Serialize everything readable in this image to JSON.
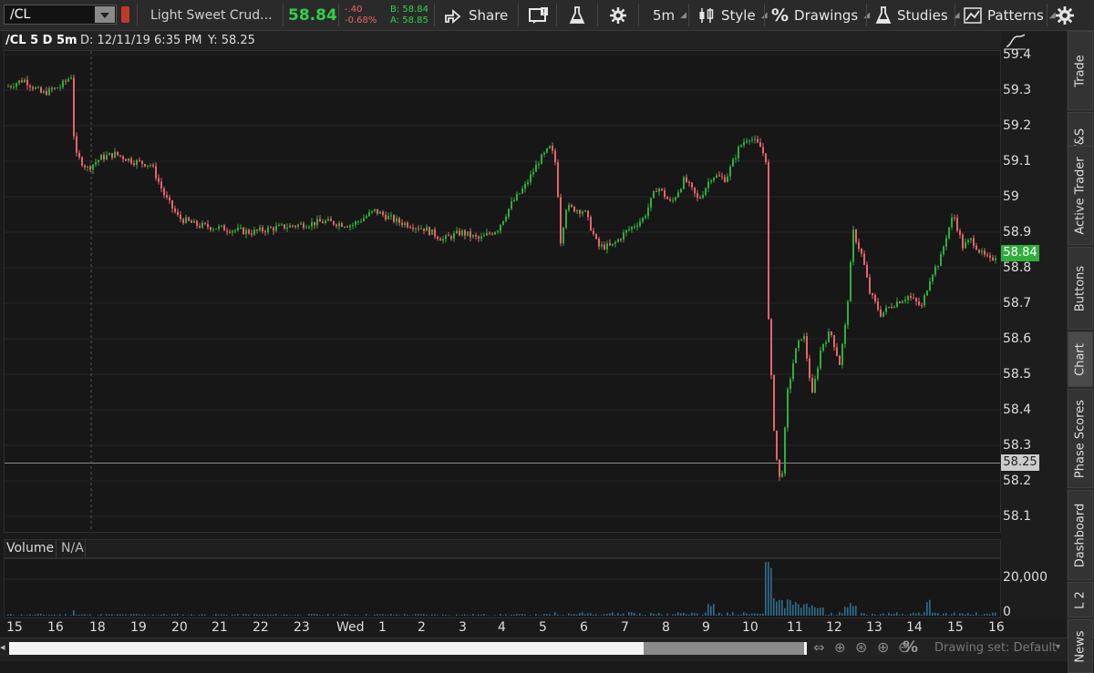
{
  "toolbar": {
    "symbol": "/CL",
    "description": "Light Sweet Crud...",
    "last": "58.84",
    "net_change": "-.40",
    "pct_change": "-0.68%",
    "bid": "B: 58.84",
    "ask": "A: 58.85",
    "share_label": "Share",
    "timeframe": "5m",
    "style_label": "Style",
    "drawings_label": "Drawings",
    "studies_label": "Studies",
    "patterns_label": "Patterns"
  },
  "chart_header": {
    "title": "/CL 5 D 5m",
    "date_readout": "D: 12/11/19 6:35 PM",
    "y_readout": "Y: 58.25"
  },
  "volume_header": {
    "label": "Volume",
    "value": "N/A"
  },
  "price_axis": {
    "ticks": [
      "59.4",
      "59.3",
      "59.2",
      "59.1",
      "59",
      "58.9",
      "58.8",
      "58.7",
      "58.6",
      "58.5",
      "58.4",
      "58.3",
      "58.2",
      "58.1"
    ],
    "last_marker": "58.84",
    "crosshair_marker": "58.25"
  },
  "volume_axis": {
    "ticks": [
      "20,000",
      "0"
    ]
  },
  "x_axis": {
    "labels": [
      "15",
      "16",
      "18",
      "19",
      "20",
      "21",
      "22",
      "23",
      "Wed",
      "1",
      "2",
      "3",
      "4",
      "5",
      "6",
      "7",
      "8",
      "9",
      "10",
      "11",
      "12",
      "13",
      "14",
      "15",
      "16"
    ]
  },
  "right_tabs": [
    "Trade",
    "T&S",
    "Active Trader",
    "Buttons",
    "Chart",
    "Phase Scores",
    "Dashboard",
    "L 2",
    "News"
  ],
  "active_tab": "Chart",
  "footer": {
    "drawing_set": "Drawing set: Default"
  },
  "colors": {
    "up": "#2fae3b",
    "down": "#e8646a",
    "last_badge": "#2fae3b",
    "accent": "#5db8e8"
  },
  "icons": {
    "share": "share-icon",
    "alert": "alert-icon",
    "flask": "flask-icon",
    "gear": "gear-icon",
    "style": "candles-icon",
    "drawings": "percent-icon",
    "studies": "flask-icon",
    "patterns": "pattern-icon"
  }
}
